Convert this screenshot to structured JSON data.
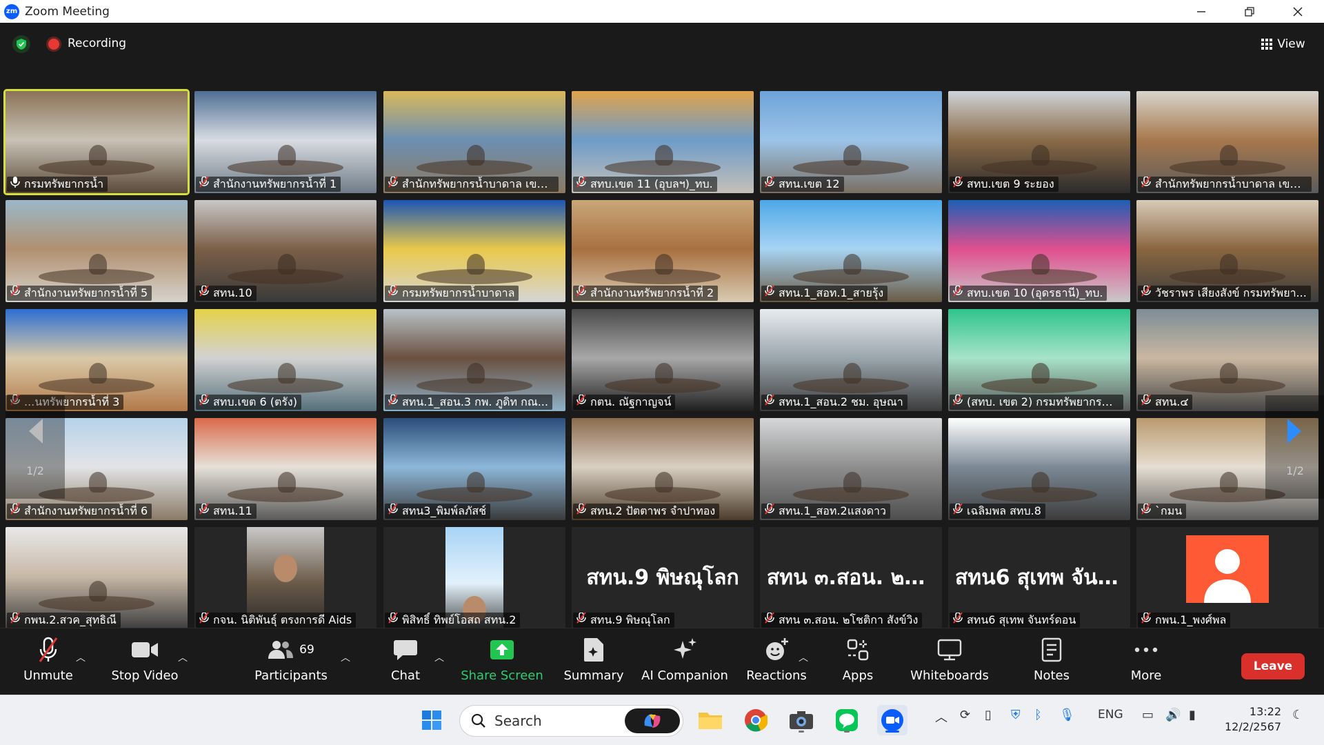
{
  "window": {
    "title": "Zoom Meeting",
    "minimize": "—",
    "restore": "❐",
    "close": "✕"
  },
  "meeting": {
    "recording_label": "Recording",
    "view_label": "View"
  },
  "grid": {
    "page_indicator": "1/2",
    "tiles": [
      {
        "name": "กรมทรัพยากรน้ำ",
        "mic": "unmuted",
        "active": true,
        "palette": [
          "#8a7356",
          "#c9c2b6",
          "#5a4a3a"
        ]
      },
      {
        "name": "สำนักงานทรัพยากรน้ำที่ 1",
        "mic": "muted",
        "palette": [
          "#4f6f94",
          "#d8dce2",
          "#6f7c88"
        ]
      },
      {
        "name": "สำนักทรัพยากรน้ำบาดาล เขต...",
        "mic": "muted",
        "palette": [
          "#d9b85a",
          "#6c8fb2",
          "#8c7a62"
        ]
      },
      {
        "name": "สทบ.เขต 11 (อุบลฯ)_ทบ.",
        "mic": "muted",
        "palette": [
          "#e0a24b",
          "#6d9cc9",
          "#c5c0b8"
        ]
      },
      {
        "name": "สทน.เขต 12",
        "mic": "muted",
        "palette": [
          "#6ea3d8",
          "#9cc4e8",
          "#7a6f63"
        ]
      },
      {
        "name": "สทบ.เขต 9 ระยอง",
        "mic": "muted",
        "palette": [
          "#cfd4d8",
          "#8a6b48",
          "#2b2b2b"
        ]
      },
      {
        "name": "สำนักทรัพยากรน้ำบาดาล เขต...",
        "mic": "muted",
        "palette": [
          "#d8d4cc",
          "#a7784d",
          "#5c5c5c"
        ]
      },
      {
        "name": "สำนักงานทรัพยากรน้ำที่ 5",
        "mic": "muted",
        "palette": [
          "#9bb8c9",
          "#b09070",
          "#d7d3cc"
        ]
      },
      {
        "name": "สทน.10",
        "mic": "muted",
        "palette": [
          "#c8c8c8",
          "#7b5f47",
          "#3a3a3a"
        ]
      },
      {
        "name": "กรมทรัพยากรน้ำบาดาล",
        "mic": "muted",
        "palette": [
          "#1c55b5",
          "#e9c94a",
          "#d5d5d5"
        ]
      },
      {
        "name": "สำนักงานทรัพยากรน้ำที่ 2",
        "mic": "muted",
        "palette": [
          "#c9a77a",
          "#a8703f",
          "#d9cbb3"
        ]
      },
      {
        "name": "สทน.1_สอท.1_สายรุ้ง",
        "mic": "muted",
        "palette": [
          "#4ea8e8",
          "#a7d4f3",
          "#6a5a45"
        ]
      },
      {
        "name": "สทบ.เขต 10 (อุดรธานี)_ทบ.",
        "mic": "muted",
        "palette": [
          "#1d5fb5",
          "#e04f8f",
          "#c9c9c9"
        ]
      },
      {
        "name": "วัชราพร เสียงสังข์ กรมทรัพยา...",
        "mic": "muted",
        "palette": [
          "#d8cbb9",
          "#8a6640",
          "#3d3d3d"
        ]
      },
      {
        "name": "...นทรัพยากรน้ำที่ 3",
        "mic": "muted",
        "palette": [
          "#2d6fd1",
          "#d9c9a8",
          "#b27a4a"
        ]
      },
      {
        "name": "สทบ.เขต 6 (ตรัง)",
        "mic": "muted",
        "palette": [
          "#e5d24a",
          "#d2d2d2",
          "#55707a"
        ]
      },
      {
        "name": "สทน.1_สอน.3 กพ. ภูดิท กณ...",
        "mic": "muted",
        "palette": [
          "#b9c3c8",
          "#6a5040",
          "#8fb2c9"
        ]
      },
      {
        "name": "กตน. ณัฐกาญจน์",
        "mic": "muted",
        "palette": [
          "#4a4a4a",
          "#a8a8a8",
          "#1f1f1f"
        ]
      },
      {
        "name": "สทน.1_สอน.2 ชม. อุษณา",
        "mic": "muted",
        "palette": [
          "#e8ecef",
          "#9aa6ad",
          "#3c3c3c"
        ]
      },
      {
        "name": "(สทบ. เขต 2) กรมทรัพยากรน้...",
        "mic": "muted",
        "palette": [
          "#2fc48b",
          "#a7e3c9",
          "#5b5b5b"
        ]
      },
      {
        "name": "สทน.๔",
        "mic": "muted",
        "palette": [
          "#7d8d96",
          "#c9b7a1",
          "#454545"
        ]
      },
      {
        "name": "สำนักงานทรัพยากรน้ำที่ 6",
        "mic": "muted",
        "palette": [
          "#b7d3ea",
          "#e2e4e6",
          "#8a7a66"
        ]
      },
      {
        "name": "สทน.11",
        "mic": "muted",
        "palette": [
          "#d96a4a",
          "#e6e1d8",
          "#5a5a5a"
        ]
      },
      {
        "name": "สทน3_พิมพ์ลภัสช์",
        "mic": "muted",
        "palette": [
          "#2b4d7a",
          "#8db7d8",
          "#3a3a3a"
        ]
      },
      {
        "name": "สทน.2 ปัตตาพร จำปาทอง",
        "mic": "muted",
        "palette": [
          "#8b6b4d",
          "#d9d0c2",
          "#4b3b2b"
        ]
      },
      {
        "name": "สทน.1_สอท.2แสงดาว",
        "mic": "muted",
        "palette": [
          "#d6d8d9",
          "#8e8e8e",
          "#4e4e4e"
        ]
      },
      {
        "name": "เฉลิมพล สทบ.8",
        "mic": "muted",
        "palette": [
          "#ffffff",
          "#7c8a96",
          "#3c3c3c"
        ]
      },
      {
        "name": "`กมน",
        "mic": "muted",
        "palette": [
          "#b99a6e",
          "#e6ded2",
          "#5d5d5d"
        ]
      },
      {
        "name": "กพน.2.สวค_สุทธิณี",
        "mic": "muted",
        "palette": [
          "#e8e8e8",
          "#c8b9a7",
          "#3e3e3e"
        ]
      },
      {
        "name": "กจน. นิติพันธุ์ ตรงการดี Aids",
        "mic": "muted",
        "palette": [
          "#c9c9c9",
          "#6a5a48",
          "#2b2b2b"
        ],
        "narrow": true
      },
      {
        "name": "พิสิทธิ์ ทิพย์โอสถ สทน.2",
        "mic": "muted",
        "palette": [
          "#a8d4f5",
          "#e2f1fb",
          "#4a4a4a"
        ],
        "narrow": true
      },
      {
        "name": "สทน.9 พิษณุโลก",
        "mic": "muted",
        "display_name": "สทน.9 พิษณุโลก",
        "video_off": true
      },
      {
        "name": "สทน ๓.สอน. ๒โชติกา สังข์วิง",
        "mic": "muted",
        "display_name": "สทน ๓.สอน. ๒โ...",
        "video_off": true
      },
      {
        "name": "สทน6 สุเทพ จันทร์ดอน",
        "mic": "muted",
        "display_name": "สทน6 สุเทพ จันท...",
        "video_off": true
      },
      {
        "name": "กพน.1_พงศ์พล",
        "mic": "muted",
        "avatar": true
      }
    ]
  },
  "toolbar": {
    "unmute": "Unmute",
    "stop_video": "Stop Video",
    "participants": "Participants",
    "participants_count": "69",
    "chat": "Chat",
    "share_screen": "Share Screen",
    "summary": "Summary",
    "ai_companion": "AI Companion",
    "reactions": "Reactions",
    "apps": "Apps",
    "whiteboards": "Whiteboards",
    "notes": "Notes",
    "more": "More",
    "leave": "Leave"
  },
  "taskbar": {
    "search_placeholder": "Search",
    "language": "ENG",
    "time": "13:22",
    "date": "12/2/2567"
  },
  "colors": {
    "accent_green": "#2ecc71",
    "leave_red": "#d9302c",
    "active_speaker": "#d6e03b",
    "zoom_blue": "#0b5cff"
  }
}
